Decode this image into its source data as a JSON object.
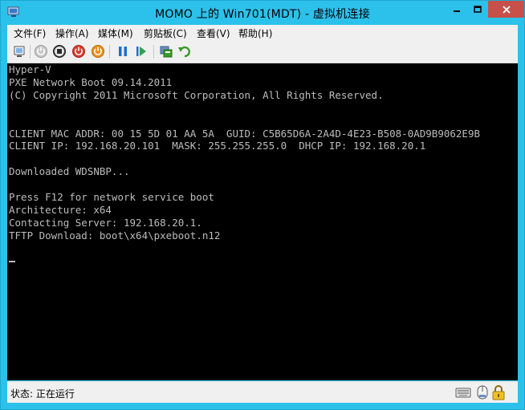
{
  "window": {
    "title": "MOMO 上的 Win701(MDT) - 虚拟机连接"
  },
  "menu": [
    {
      "label": "文件(F)"
    },
    {
      "label": "操作(A)"
    },
    {
      "label": "媒体(M)"
    },
    {
      "label": "剪贴板(C)"
    },
    {
      "label": "查看(V)"
    },
    {
      "label": "帮助(H)"
    }
  ],
  "toolbar": {
    "icons": [
      "ctrl-alt-del-icon",
      "start-icon",
      "turn-off-icon",
      "shutdown-icon",
      "save-state-icon",
      "pause-icon",
      "reset-icon",
      "checkpoint-icon",
      "revert-icon"
    ],
    "colors": {
      "shutdown": "#d93a2e",
      "save": "#e8901a",
      "pause_reset": "#1d6fd0",
      "revert": "#3a9a2a"
    }
  },
  "console": {
    "lines": [
      "Hyper-V",
      "PXE Network Boot 09.14.2011",
      "(C) Copyright 2011 Microsoft Corporation, All Rights Reserved.",
      "",
      "",
      "CLIENT MAC ADDR: 00 15 5D 01 AA 5A  GUID: C5B65D6A-2A4D-4E23-B508-0AD9B9062E9B",
      "CLIENT IP: 192.168.20.101  MASK: 255.255.255.0  DHCP IP: 192.168.20.1",
      "",
      "Downloaded WDSNBP...",
      "",
      "Press F12 for network service boot",
      "Architecture: x64",
      "Contacting Server: 192.168.20.1.",
      "TFTP Download: boot\\x64\\pxeboot.n12",
      ""
    ]
  },
  "status": {
    "text": "状态: 正在运行",
    "icons": [
      "keyboard-icon",
      "mouse-icon",
      "lock-icon"
    ]
  }
}
